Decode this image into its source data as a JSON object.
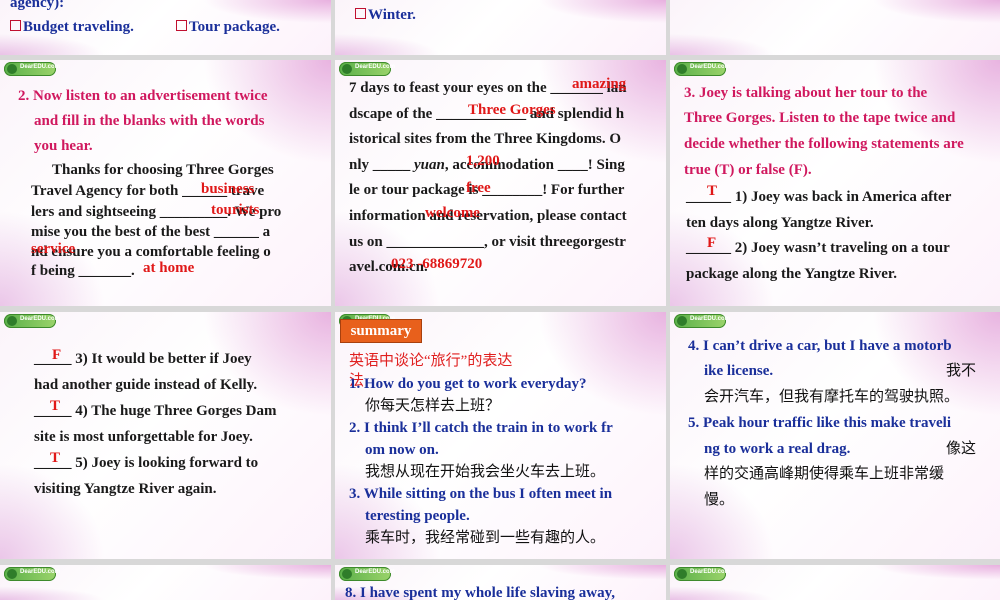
{
  "row0": {
    "s1": {
      "line_a": "agency):",
      "opt1": "Budget traveling.",
      "opt2": "Tour package."
    },
    "s2": {
      "opt": "Winter."
    }
  },
  "slide_listen": {
    "title_l1": "2. Now listen to an advertisement twice",
    "title_l2": "and fill in the blanks with the words",
    "title_l3": "you hear.",
    "p1": "Thanks for choosing Three Gorges",
    "p2": "Travel Agency for both ______ trave",
    "p3": "lers and sightseeing _________. We pro",
    "p4": "mise you the best of the best ______ a",
    "p5": "nd ensure you a comfortable feeling o",
    "p6": "f being _______.",
    "ans_business": "business",
    "ans_tourists": "tourists",
    "ans_service": "service",
    "ans_athome": "at home"
  },
  "slide_ad": {
    "p1": "7 days to feast your eyes on the _______ lan",
    "p2": "dscape of the ____________ and splendid h",
    "p3": "istorical sites from the Three Kingdoms. O",
    "p4a": "nly _____ ",
    "p4b": "yuan",
    "p4c": ", accommodation ____! Sing",
    "p5": "le or tour package is ________! For further",
    "p6": "information and reservation, please contact",
    "p7": "us on _____________, or visit threegorgestr",
    "p8": "avel.com.cn.",
    "ans_amazing": "amazing",
    "ans_gorges": "Three Gorges",
    "ans_price": "1,200",
    "ans_free": "free",
    "ans_welcome": "welcome",
    "ans_phone": "023 -68869720"
  },
  "slide_tf1": {
    "t1": "3. Joey is talking about her tour to the",
    "t2": "Three Gorges. Listen to the tape twice and",
    "t3": "decide whether the following statements are",
    "t4": "true (T) or false (F).",
    "q1a": "______ 1) Joey was back in America after",
    "q1b": "ten days along Yangtze River.",
    "q2a": "______ 2) Joey wasn’t traveling on a tour",
    "q2b": "package along the Yangtze River.",
    "a1": "T",
    "a2": "F"
  },
  "slide_tf2": {
    "q3a": "_____ 3) It would be better if Joey",
    "q3b": "had another guide instead of Kelly.",
    "q4a": "_____ 4) The huge Three Gorges Dam",
    "q4b": "site is most unforgettable for Joey.",
    "q5a": "_____ 5) Joey is looking forward to",
    "q5b": "visiting Yangtze River again.",
    "a3": "F",
    "a4": "T",
    "a5": "T"
  },
  "slide_summary": {
    "button": "summary",
    "heading": "英语中谈论“旅行”的表达",
    "heading2": "法",
    "s1": "1. How do you get to work everyday?",
    "s1cn": "你每天怎样去上班？",
    "s2a": "2. I think I’ll catch the train in to work fr",
    "s2b": "om now on.",
    "s2cn": "我想从现在开始我会坐火车去上班。",
    "s3a": "3. While sitting on the bus I often meet in",
    "s3b": "teresting people.",
    "s3cn": "乘车时，我经常碰到一些有趣的人。"
  },
  "slide_more": {
    "s4a": "4. I can’t drive a car, but I have a motorb",
    "s4b": "ike license.",
    "s4cn1": "我不",
    "s4cn2": "会开汽车，但我有摩托车的驾驶执照。",
    "s5a": "5. Peak hour traffic like this make traveli",
    "s5b": "ng to work a real drag.",
    "s5cn1": "像这",
    "s5cn2": "样的交通高峰期使得乘车上班非常缓",
    "s5cn3": "慢。"
  },
  "row3": {
    "s8": "8. I have spent my whole life slaving away,"
  }
}
